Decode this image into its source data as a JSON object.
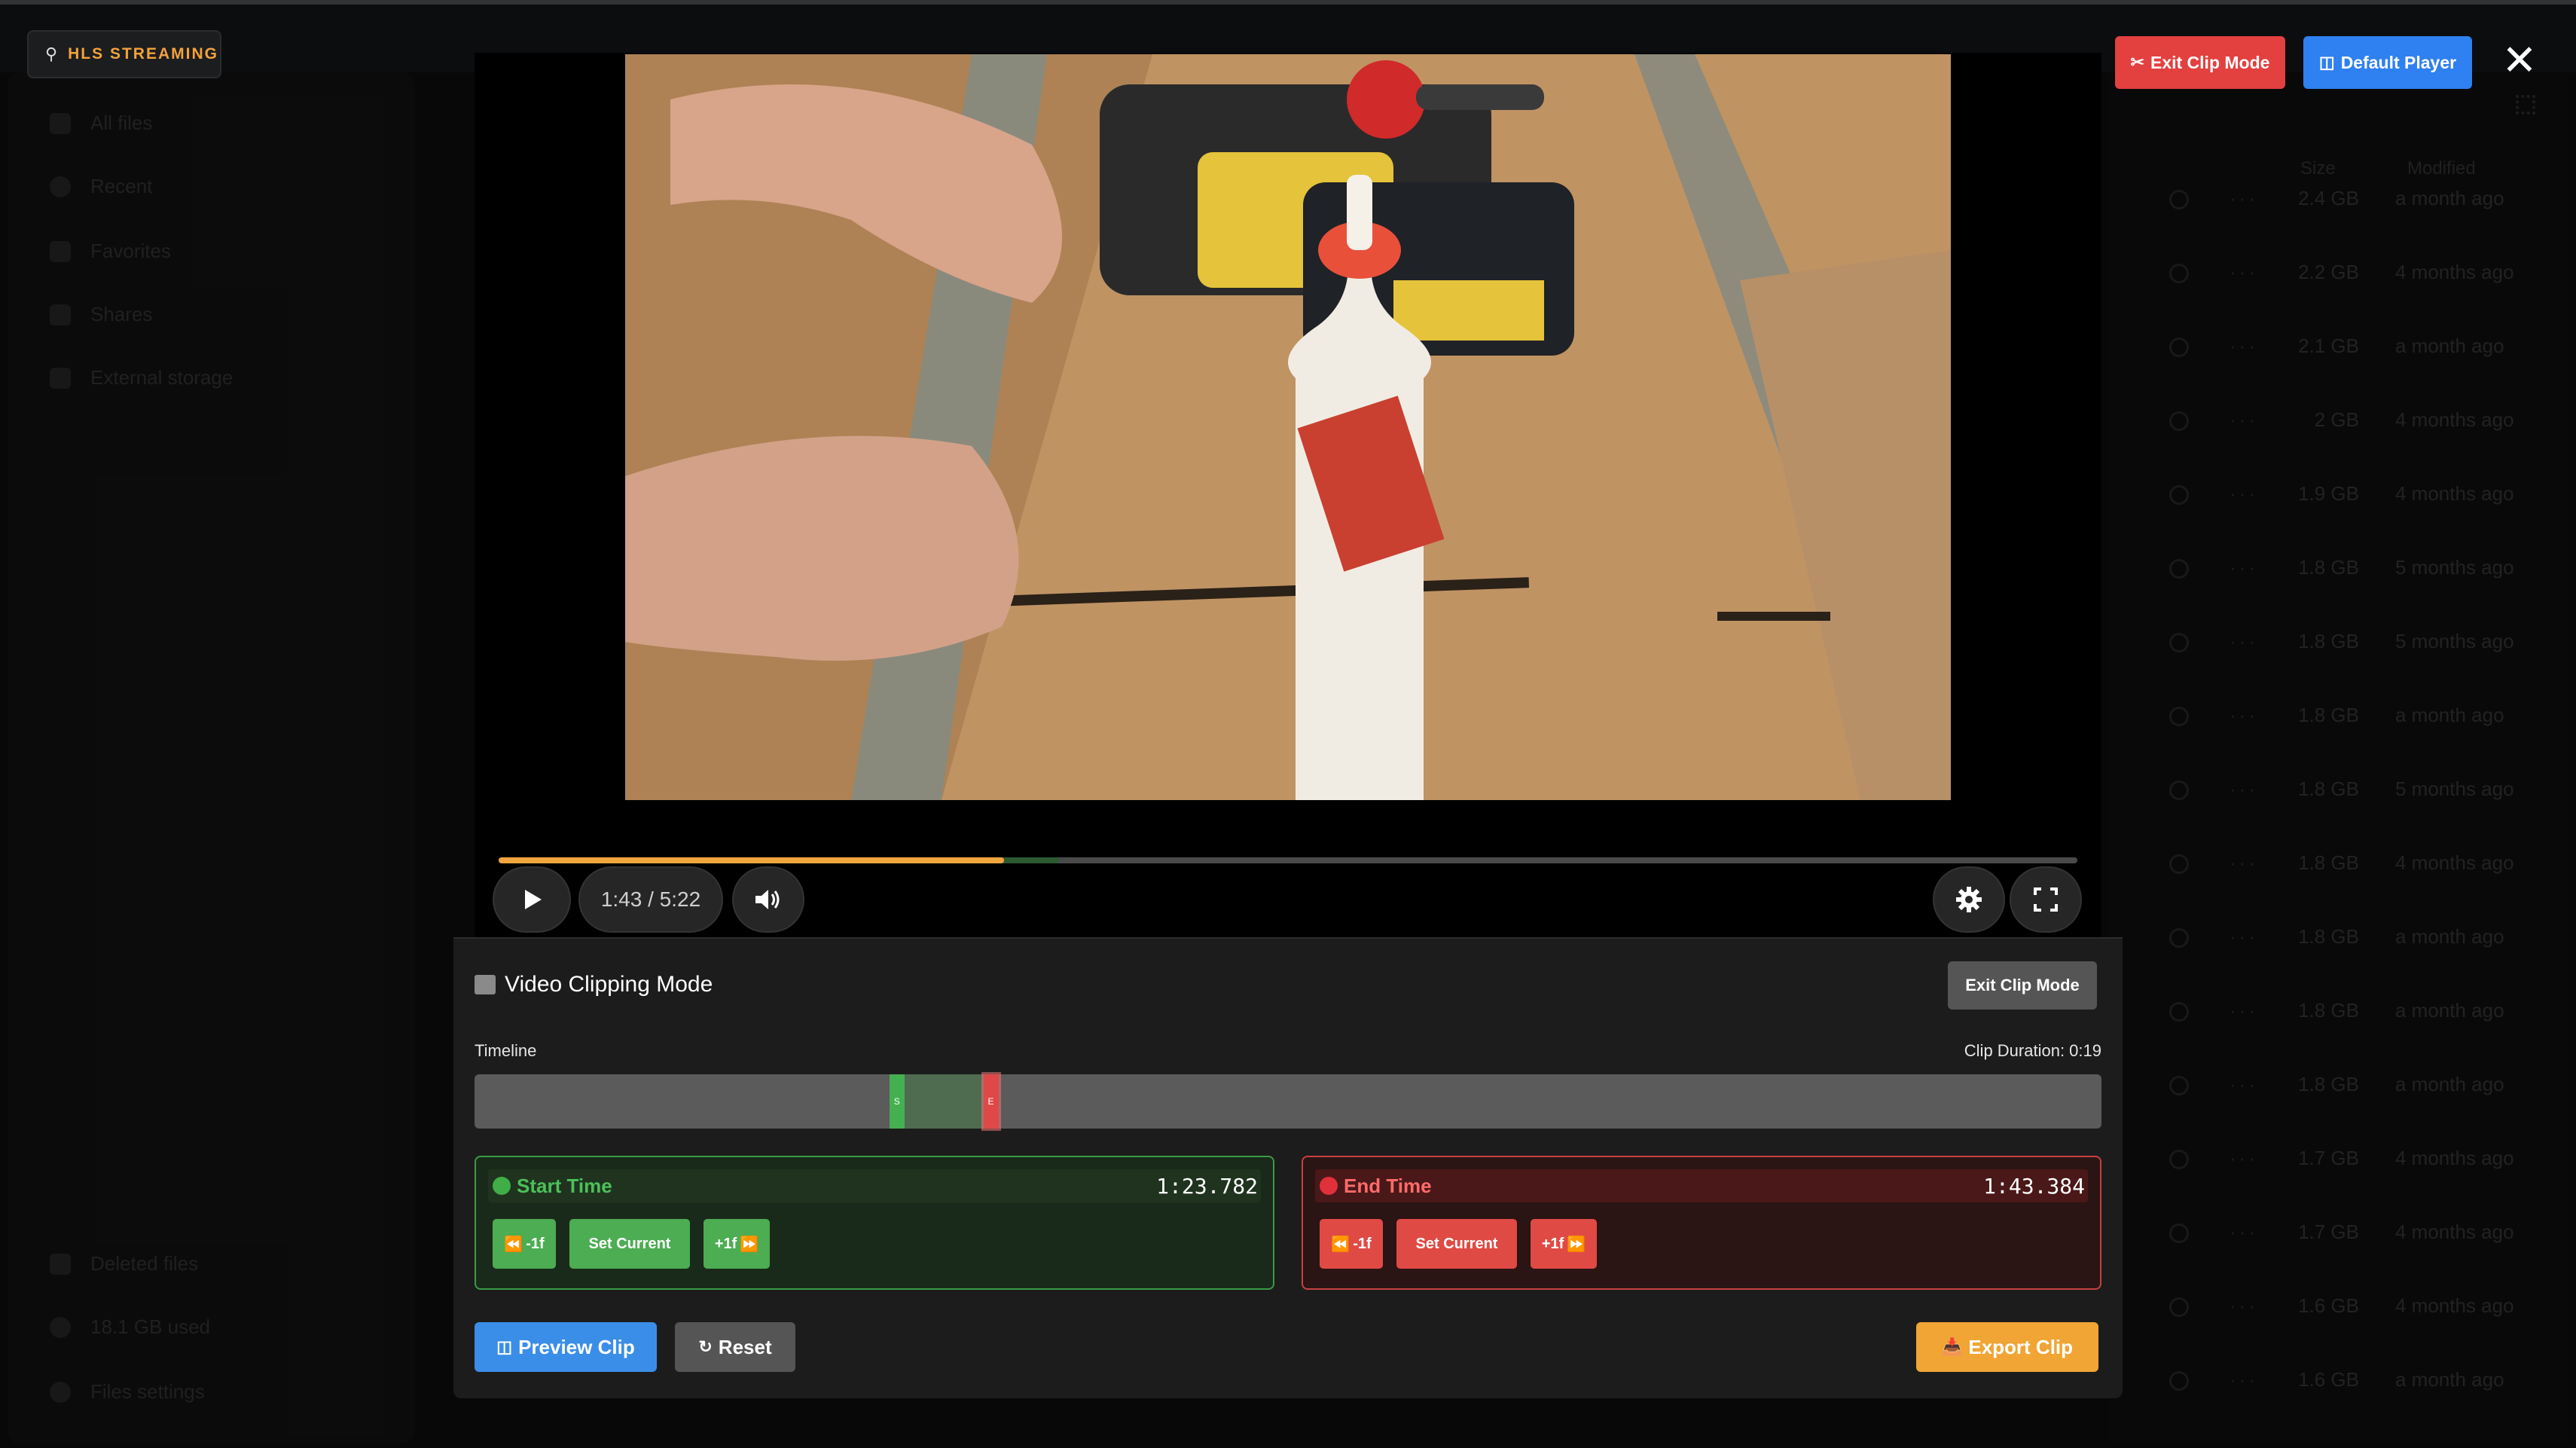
{
  "background": {
    "sidebar": {
      "items": [
        {
          "label": "All files"
        },
        {
          "label": "Recent"
        },
        {
          "label": "Favorites"
        },
        {
          "label": "Shares"
        },
        {
          "label": "External storage"
        }
      ],
      "footer": [
        {
          "label": "Deleted files"
        },
        {
          "label": "18.1 GB used"
        },
        {
          "label": "Files settings"
        }
      ]
    },
    "columns": {
      "size": "Size",
      "modified": "Modified"
    },
    "files": [
      {
        "size": "2.4 GB",
        "modified": "a month ago"
      },
      {
        "size": "2.2 GB",
        "modified": "4 months ago"
      },
      {
        "size": "2.1 GB",
        "modified": "a month ago"
      },
      {
        "size": "2 GB",
        "modified": "4 months ago"
      },
      {
        "size": "1.9 GB",
        "modified": "4 months ago"
      },
      {
        "size": "1.8 GB",
        "modified": "5 months ago"
      },
      {
        "size": "1.8 GB",
        "modified": "5 months ago"
      },
      {
        "size": "1.8 GB",
        "modified": "a month ago"
      },
      {
        "size": "1.8 GB",
        "modified": "5 months ago"
      },
      {
        "size": "1.8 GB",
        "modified": "4 months ago"
      },
      {
        "size": "1.8 GB",
        "modified": "a month ago"
      },
      {
        "size": "1.8 GB",
        "modified": "a month ago"
      },
      {
        "size": "1.8 GB",
        "modified": "a month ago"
      },
      {
        "size": "1.7 GB",
        "modified": "4 months ago"
      },
      {
        "size": "1.7 GB",
        "modified": "4 months ago"
      },
      {
        "size": "1.6 GB",
        "modified": "4 months ago"
      },
      {
        "size": "1.6 GB",
        "modified": "a month ago"
      }
    ]
  },
  "hls_badge": {
    "icon": "satellite-icon",
    "label": "HLS STREAMING"
  },
  "top_actions": {
    "exit_clip_mode": {
      "icon": "scissors-icon",
      "label": "Exit Clip Mode"
    },
    "default_player": {
      "icon": "clapperboard-icon",
      "label": "Default Player"
    },
    "close_icon": "close-icon"
  },
  "player": {
    "time": "1:43 / 5:22",
    "progress_played_fraction": 0.32,
    "buffered_end_fraction": 0.355,
    "icons": {
      "play": "play-icon",
      "volume": "volume-icon",
      "settings": "gear-icon",
      "fullscreen": "fullscreen-icon"
    }
  },
  "clip_panel": {
    "title": "Video Clipping Mode",
    "title_icon": "clapperboard-icon",
    "exit_button": "Exit Clip Mode",
    "timeline_label": "Timeline",
    "clip_duration": "Clip Duration: 0:19",
    "timeline": {
      "start_fraction": 0.255,
      "end_fraction": 0.322,
      "start_handle_label": "S",
      "end_handle_label": "E"
    },
    "start": {
      "label": "Start Time",
      "value": "1:23.782",
      "buttons": {
        "back": "-1f",
        "set": "Set Current",
        "forward": "+1f"
      }
    },
    "end": {
      "label": "End Time",
      "value": "1:43.384",
      "buttons": {
        "back": "-1f",
        "set": "Set Current",
        "forward": "+1f"
      }
    },
    "actions": {
      "preview": {
        "icon": "clapperboard-icon",
        "label": "Preview Clip"
      },
      "reset": {
        "icon": "reset-icon",
        "label": "Reset"
      },
      "export": {
        "icon": "download-tray-icon",
        "label": "Export Clip"
      }
    }
  },
  "colors": {
    "accent_orange": "#f0a534",
    "start_green": "#4cad52",
    "end_red": "#e04a44",
    "preview_blue": "#3a8ee8",
    "exit_red": "#e34040"
  }
}
